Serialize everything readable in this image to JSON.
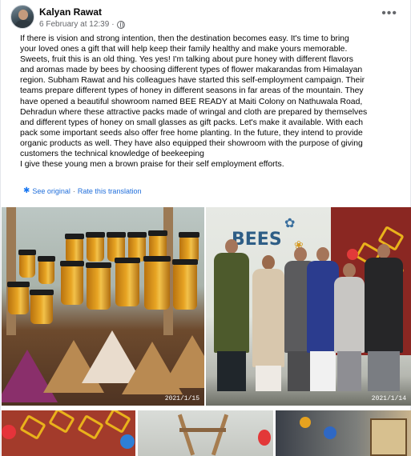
{
  "post": {
    "author": "Kalyan Rawat",
    "date": "6 February at 12:39",
    "separator": "·",
    "privacy_icon": "globe-icon",
    "more_icon": "ellipsis-icon",
    "text": "If there is vision and strong intention, then the destination becomes easy. It's time to bring\nyour loved ones a gift that will help keep their family healthy and make yours memorable.\nSweets, fruit this is an old thing. Yes yes! I'm talking about pure honey with different flavors\nand aromas made by bees by choosing different types of flower makarandas from Himalayan\nregion. Subham Rawat and his colleagues have started this self-employment campaign. Their\nteams prepare different types of honey in different seasons in far areas of the mountain. They\nhave opened a beautiful showroom named BEE READY at Maiti Colony on Nathuwala Road,\nDehradun where these attractive packs made of wringal and cloth are prepared by themselves\nand different types of honey on small glasses as gift packs. Let's make it available. With each\npack some important seeds also offer free home planting. In the future, they intend to provide\norganic products as well. They have also equipped their showroom with the purpose of giving\ncustomers the technical knowledge of beekeeping\nI give these young men a brown praise for their self employment efforts."
  },
  "translation": {
    "icon": "gear-icon",
    "see_original": "See original",
    "dot": "·",
    "rate": "Rate this translation"
  },
  "photos": {
    "photo1_stamp": "2021/1/15",
    "photo2_stamp": "2021/1/14",
    "mural_text": "BEES"
  },
  "colors": {
    "link": "#216fdb",
    "meta": "#65676b",
    "honey": "#e7a423",
    "wall_red": "#8a2722"
  }
}
